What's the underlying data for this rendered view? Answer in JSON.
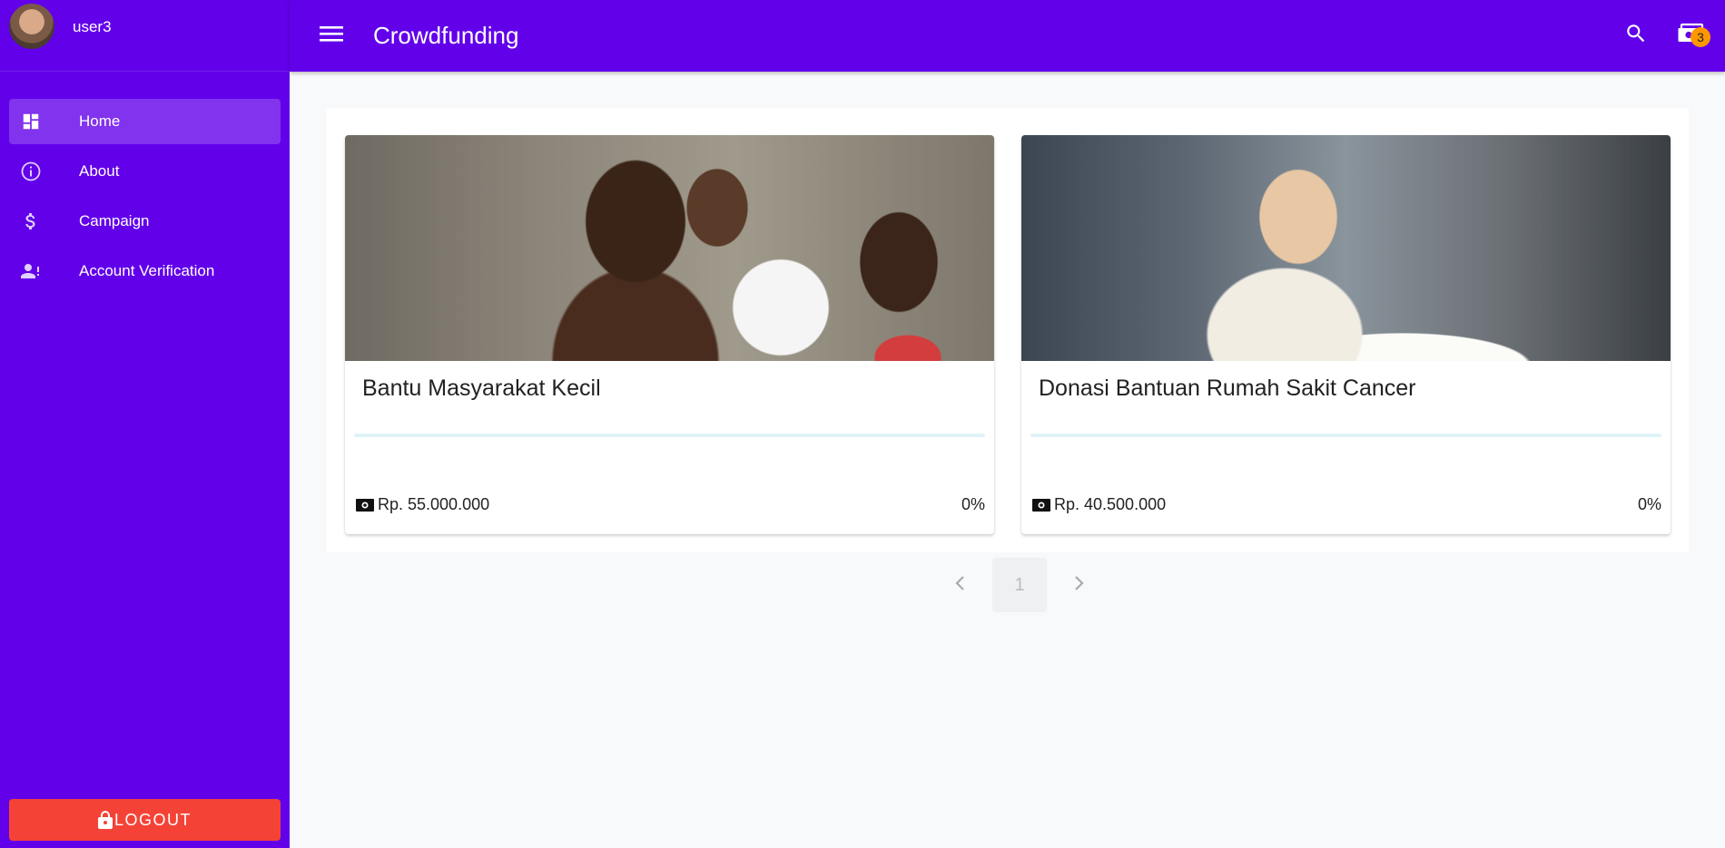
{
  "user": {
    "name": "user3"
  },
  "app": {
    "title": "Crowdfunding"
  },
  "sidebar": {
    "items": [
      {
        "label": "Home",
        "icon": "dashboard-icon",
        "active": true
      },
      {
        "label": "About",
        "icon": "info-icon",
        "active": false
      },
      {
        "label": "Campaign",
        "icon": "dollar-icon",
        "active": false
      },
      {
        "label": "Account Verification",
        "icon": "account-alert-icon",
        "active": false
      }
    ],
    "logout_label": "LOGOUT"
  },
  "topbar": {
    "notification_count": "3"
  },
  "campaigns": [
    {
      "title": "Bantu Masyarakat Kecil",
      "amount": "Rp. 55.000.000",
      "percent": "0%",
      "progress": 0
    },
    {
      "title": "Donasi Bantuan Rumah Sakit Cancer",
      "amount": "Rp. 40.500.000",
      "percent": "0%",
      "progress": 0
    }
  ],
  "pagination": {
    "current": "1"
  },
  "colors": {
    "primary": "#6200ea",
    "logout": "#f44336",
    "badge": "#ff9800",
    "progress_track": "#dff3f7"
  }
}
